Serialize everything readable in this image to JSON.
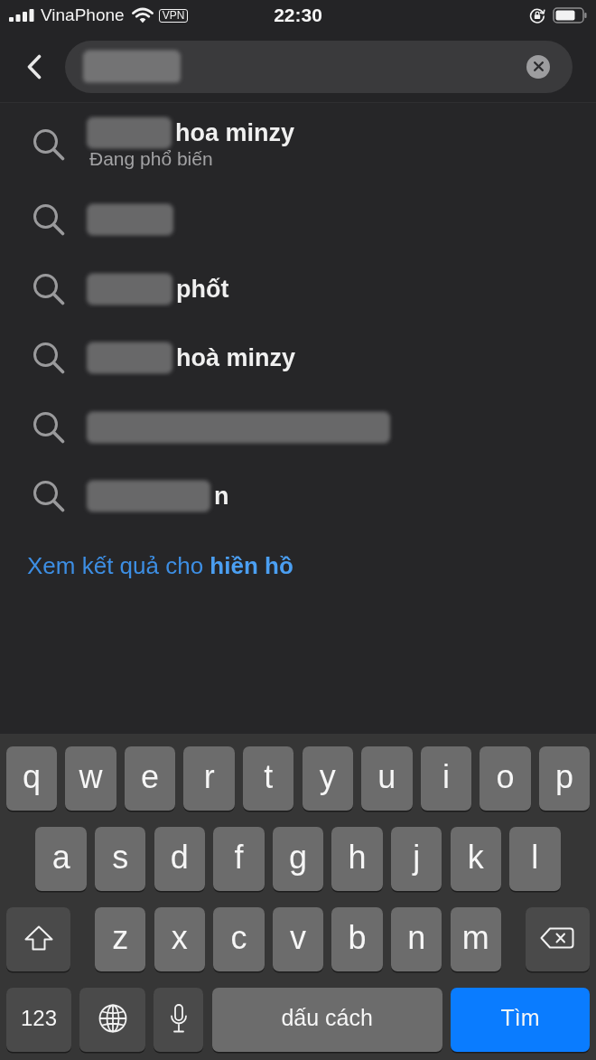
{
  "status_bar": {
    "carrier": "VinaPhone",
    "vpn": "VPN",
    "time": "22:30"
  },
  "search": {
    "redacted": true
  },
  "suggestions": [
    {
      "text": "hoa minzy",
      "redacted": true,
      "subtitle": "Đang phổ biến"
    },
    {
      "redacted": true
    },
    {
      "text": "phốt",
      "redacted": true
    },
    {
      "text": "hoà minzy",
      "redacted": true
    },
    {
      "redacted": true
    },
    {
      "text": "n",
      "redacted": true
    }
  ],
  "see_results_link": "Xem kết quả cho **hiền hồ**",
  "keyboard": {
    "rows": [
      {
        "keys": [
          {
            "kind": "letter",
            "label": "q"
          },
          {
            "kind": "letter",
            "label": "w"
          },
          {
            "kind": "letter",
            "label": "e"
          },
          {
            "kind": "letter",
            "label": "r"
          },
          {
            "kind": "letter",
            "label": "t"
          },
          {
            "kind": "letter",
            "label": "y"
          },
          {
            "kind": "letter",
            "label": "u"
          },
          {
            "kind": "letter",
            "label": "i"
          },
          {
            "kind": "letter",
            "label": "o"
          },
          {
            "kind": "letter",
            "label": "p"
          }
        ]
      },
      {
        "keys": [
          {
            "kind": "letter",
            "label": "a"
          },
          {
            "kind": "letter",
            "label": "s"
          },
          {
            "kind": "letter",
            "label": "d"
          },
          {
            "kind": "letter",
            "label": "f"
          },
          {
            "kind": "letter",
            "label": "g"
          },
          {
            "kind": "letter",
            "label": "h"
          },
          {
            "kind": "letter",
            "label": "j"
          },
          {
            "kind": "letter",
            "label": "k"
          },
          {
            "kind": "letter",
            "label": "l"
          }
        ]
      },
      {
        "keys": [
          {
            "kind": "shift"
          },
          {
            "kind": "letter",
            "label": "z"
          },
          {
            "kind": "letter",
            "label": "x"
          },
          {
            "kind": "letter",
            "label": "c"
          },
          {
            "kind": "letter",
            "label": "v"
          },
          {
            "kind": "letter",
            "label": "b"
          },
          {
            "kind": "letter",
            "label": "n"
          },
          {
            "kind": "letter",
            "label": "m"
          },
          {
            "kind": "delete"
          }
        ]
      },
      {
        "keys": [
          {
            "kind": "numbers",
            "label": "123"
          },
          {
            "kind": "globe"
          },
          {
            "kind": "mic"
          },
          {
            "kind": "space",
            "label": "dấu cách"
          },
          {
            "kind": "action",
            "label": "Tìm"
          }
        ]
      }
    ]
  }
}
